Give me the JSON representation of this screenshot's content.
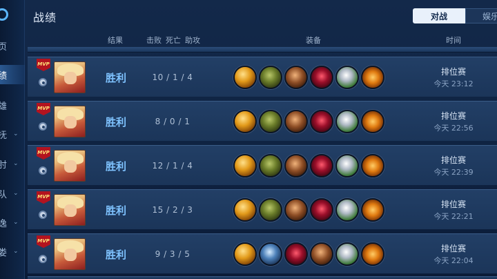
{
  "page": {
    "title": "战绩"
  },
  "tabs": [
    {
      "label": "对战",
      "active": true
    },
    {
      "label": "娱乐",
      "active": false
    }
  ],
  "sidebar": {
    "items": [
      {
        "label": "页",
        "has_chevron": false,
        "active": false
      },
      {
        "label": "绩",
        "has_chevron": false,
        "active": true
      },
      {
        "label": "雄",
        "has_chevron": false,
        "active": false
      },
      {
        "label": "抚",
        "has_chevron": true,
        "active": false
      },
      {
        "label": "肘",
        "has_chevron": true,
        "active": false
      },
      {
        "label": "队",
        "has_chevron": true,
        "active": false
      },
      {
        "label": "逸",
        "has_chevron": true,
        "active": false
      },
      {
        "label": "娄",
        "has_chevron": true,
        "active": false
      }
    ]
  },
  "columns": {
    "result": "结果",
    "kills": "击败",
    "deaths": "死亡",
    "assists": "助攻",
    "items": "装备",
    "time": "时间"
  },
  "rows": [
    {
      "mvp": "MVP",
      "result": "胜利",
      "kda": "10 / 1 / 4",
      "mode": "排位赛",
      "time": "今天 23:12",
      "items": [
        "gold-blade-icon",
        "boots-icon",
        "brown-armor-icon",
        "red-crystal-icon",
        "silver-shield-icon",
        "golden-wing-icon"
      ]
    },
    {
      "mvp": "MVP",
      "result": "胜利",
      "kda": "8 / 0 / 1",
      "mode": "排位赛",
      "time": "今天 22:56",
      "items": [
        "gold-blade-icon",
        "boots-icon",
        "brown-armor-icon",
        "red-crystal-icon",
        "silver-shield-icon",
        "golden-wing-icon"
      ]
    },
    {
      "mvp": "MVP",
      "result": "胜利",
      "kda": "12 / 1 / 4",
      "mode": "排位赛",
      "time": "今天 22:39",
      "items": [
        "gold-blade-icon",
        "boots-icon",
        "brown-armor-icon",
        "red-crystal-icon",
        "silver-shield-icon",
        "golden-wing-icon"
      ]
    },
    {
      "mvp": "MVP",
      "result": "胜利",
      "kda": "15 / 2 / 3",
      "mode": "排位赛",
      "time": "今天 22:21",
      "items": [
        "gold-blade-icon",
        "boots-icon",
        "brown-armor-icon",
        "red-crystal-icon",
        "silver-shield-icon",
        "golden-wing-icon"
      ]
    },
    {
      "mvp": "MVP",
      "result": "胜利",
      "kda": "9 / 3 / 5",
      "mode": "排位赛",
      "time": "今天 22:04",
      "items": [
        "gold-blade-icon",
        "blue-boots-icon",
        "red-crystal-icon",
        "brown-armor-icon",
        "silver-shield-icon",
        "golden-wing-icon"
      ]
    }
  ],
  "colors": {
    "accent": "#7fc3ff",
    "background": "#0f2342",
    "tab_active_bg": "#e9f1fb"
  }
}
